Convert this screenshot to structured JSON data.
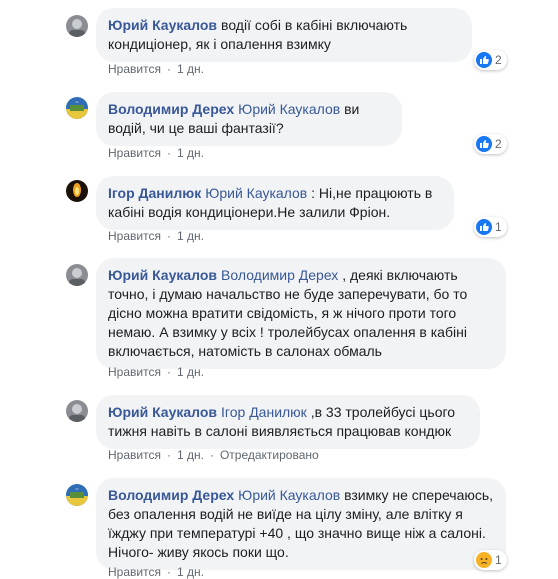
{
  "comments": [
    {
      "author": "Юрий Каукалов",
      "mention": "",
      "text": "водії собі в кабіні включають кондиціонер, як і опалення взимку",
      "like_label": "Нравится",
      "time": "1 дн.",
      "edited": "",
      "reaction": {
        "icon": "like-icon",
        "count": "2"
      },
      "avatar": "avatar-gray"
    },
    {
      "author": "Володимир Дерех",
      "mention": "Юрий Каукалов",
      "text": "ви водій, чи це ваші фантазії?",
      "like_label": "Нравится",
      "time": "1 дн.",
      "edited": "",
      "reaction": {
        "icon": "like-icon",
        "count": "2"
      },
      "avatar": "avatar-flag"
    },
    {
      "author": "Ігор Данилюк",
      "mention": "Юрий Каукалов",
      "text": ": Ні,не працюють в кабіні водія кондиціонери.Не залили Фріон.",
      "like_label": "Нравится",
      "time": "1 дн.",
      "edited": "",
      "reaction": {
        "icon": "like-icon",
        "count": "1"
      },
      "avatar": "avatar-candle"
    },
    {
      "author": "Юрий Каукалов",
      "mention": "Володимир Дерех",
      "text": ", деякі включають точно, і думаю начальство не буде заперечувати, бо то дісно можна вратити свідомість, я ж нічого проти того немаю. А взимку у всіх ! тролейбусах опалення в кабіні включається, натомість в салонах обмаль",
      "like_label": "Нравится",
      "time": "1 дн.",
      "edited": "",
      "reaction": null,
      "avatar": "avatar-gray"
    },
    {
      "author": "Юрий Каукалов",
      "mention": "Ігор Данилюк",
      "text": ",в 33 тролейбусі цього тижня навіть в салоні виявляється працював кондюк",
      "like_label": "Нравится",
      "time": "1 дн.",
      "edited": "Отредактировано",
      "reaction": null,
      "avatar": "avatar-gray"
    },
    {
      "author": "Володимир Дерех",
      "mention": "Юрий Каукалов",
      "text": "взимку не сперечаюсь, без опалення водій не виїде на цілу зміну, але влітку я їжджу при температурі +40 , що значно вище ніж а салоні. Нічого- живу якось поки що.",
      "like_label": "Нравится",
      "time": "1 дн.",
      "edited": "",
      "reaction": {
        "icon": "sad-icon",
        "count": "1"
      },
      "avatar": "avatar-flag"
    }
  ]
}
